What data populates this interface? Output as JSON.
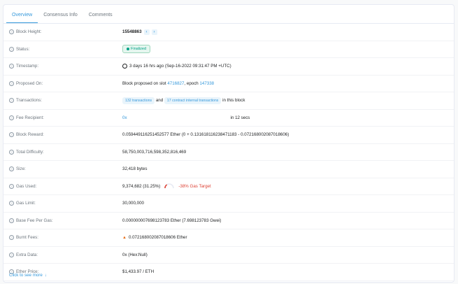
{
  "tabs": [
    "Overview",
    "Consensus Info",
    "Comments"
  ],
  "rows": {
    "block_height": {
      "label": "Block Height:",
      "value": "15548863"
    },
    "status": {
      "label": "Status:",
      "value": "Finalized"
    },
    "timestamp": {
      "label": "Timestamp:",
      "value": "3 days 16 hrs ago (Sep-16-2022 09:31:47 PM +UTC)"
    },
    "proposed_on": {
      "label": "Proposed On:",
      "prefix": "Block proposed on slot",
      "slot": "4716827",
      "mid": ", epoch",
      "epoch": "147338"
    },
    "transactions": {
      "label": "Transactions:",
      "txns": "132 transactions",
      "and": "and",
      "internal": "17 contract internal transactions",
      "suffix": "in this block"
    },
    "fee_recipient": {
      "label": "Fee Recipient:",
      "value": "0x",
      "suffix": "in 12 secs"
    },
    "block_reward": {
      "label": "Block Reward:",
      "value": "0.059449116251452577 Ether (0 + 0.131618116238471183 - 0.072168002087018606)"
    },
    "total_difficulty": {
      "label": "Total Difficulty:",
      "value": "58,750,003,716,598,352,816,469"
    },
    "size": {
      "label": "Size:",
      "value": "32,418 bytes"
    },
    "gas_used": {
      "label": "Gas Used:",
      "value": "9,374,682 (31.25%)",
      "target": "-38% Gas Target",
      "percent": 31.25
    },
    "gas_limit": {
      "label": "Gas Limit:",
      "value": "30,000,000"
    },
    "base_fee": {
      "label": "Base Fee Per Gas:",
      "value": "0.000000007698123783 Ether (7.698123783 Gwei)"
    },
    "burnt_fees": {
      "label": "Burnt Fees:",
      "value": "0.072168002087018606 Ether"
    },
    "extra_data": {
      "label": "Extra Data:",
      "value": "0x (Hex:Null)"
    },
    "ether_price": {
      "label": "Ether Price:",
      "value": "$1,433.97 / ETH"
    }
  },
  "more_link": "Click to see more",
  "icons": {
    "help": "question-circle-icon",
    "prev": "chevron-left-icon",
    "next": "chevron-right-icon",
    "clock": "clock-icon",
    "fire": "fire-icon",
    "arrow": "arrow-down-icon"
  },
  "colors": {
    "accent": "#3498db",
    "success": "#00a186",
    "danger": "#de4437"
  }
}
